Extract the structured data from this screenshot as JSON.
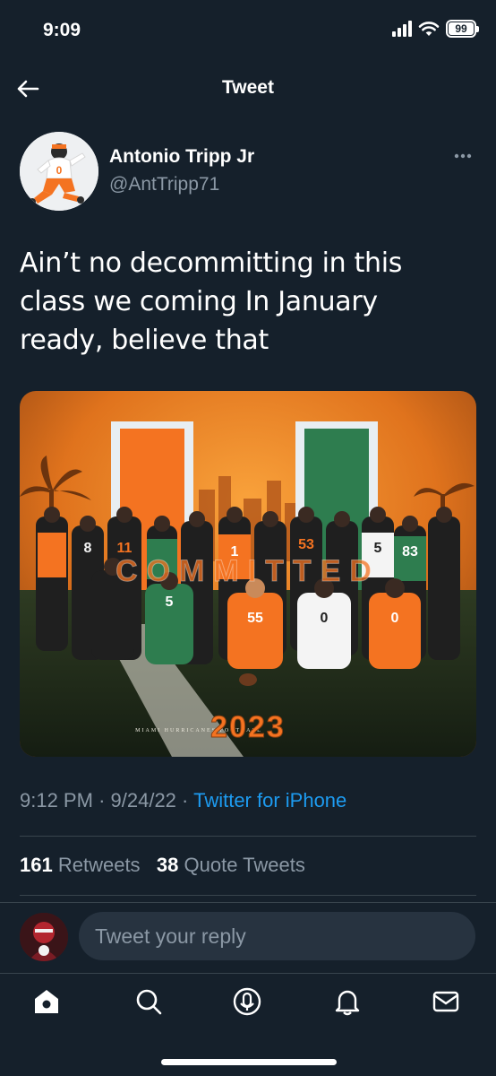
{
  "status": {
    "time": "9:09",
    "battery": "99",
    "battery_level": 0.99
  },
  "nav": {
    "title": "Tweet"
  },
  "author": {
    "name": "Antonio Tripp Jr",
    "handle": "@AntTripp71"
  },
  "tweet": {
    "text": "Ain’t no decommitting in this class we coming In January ready, believe that",
    "time": "9:12 PM",
    "date": "9/24/22",
    "separator": "·",
    "source": "Twitter for iPhone"
  },
  "media": {
    "banner": "COMMITTED",
    "subtitle": "MIAMI HURRICANES FOOTBALL",
    "year": "2023",
    "jersey_numbers": [
      "8",
      "11",
      "1",
      "53",
      "5",
      "83",
      "5",
      "55",
      "0",
      "0"
    ]
  },
  "stats": {
    "retweets_count": "161",
    "retweets_label": "Retweets",
    "quotes_count": "38",
    "quotes_label": "Quote Tweets"
  },
  "reply": {
    "placeholder": "Tweet your reply"
  },
  "tabs": [
    "home-icon",
    "search-icon",
    "spaces-icon",
    "notifications-icon",
    "messages-icon"
  ],
  "colors": {
    "background": "#15202b",
    "accent": "#1d9bf0",
    "secondary_text": "#8b98a5",
    "divider": "#38444d"
  }
}
